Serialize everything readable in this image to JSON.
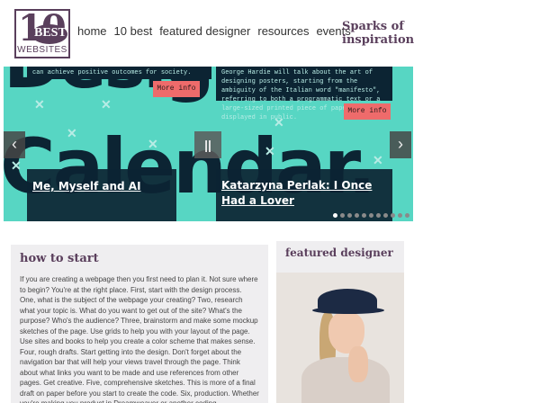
{
  "logo": {
    "number": "10",
    "badge": "BEST",
    "caption": "WEBSITES"
  },
  "nav": {
    "items": [
      "home",
      "10 best",
      "featured designer",
      "resources",
      "events"
    ],
    "tagline": "Sparks of inspiration"
  },
  "carousel": {
    "bg_word_top": "Design",
    "bg_word_main": "Calendar.",
    "slides": [
      {
        "excerpt": "can achieve positive outcomes for society.",
        "button": "More info",
        "card_title": "Me, Myself and AI"
      },
      {
        "excerpt": "George Hardie will talk about the art of designing posters, starting from the ambiguity of the Italian word \"manifesto\", referring to both a programmatic text or a large-sized printed piece of paper displayed in public.",
        "button": "More info",
        "card_title": "Katarzyna Perlak: I Once Had a Lover"
      }
    ],
    "prev_icon": "chevron-left-icon",
    "next_icon": "chevron-right-icon",
    "pause_icon": "pause-icon",
    "dot_count": 11,
    "active_dot": 0,
    "accent_color": "#57d6c3",
    "dark_color": "#0c2433",
    "button_color": "#ee6b6b"
  },
  "main": {
    "title": "how to start",
    "body": "If you are creating a webpage then you first need to plan it. Not sure where to begin? You're at the right place. First, start with the design process. One, what is the subject of the webpage your creating? Two, research what your topic is. What do you want to get out of the site? What's the purpose? Who's the audience? Three, brainstorm and make some mockup sketches of the page. Use grids to help you with your layout of the page. Use sites and books to help you create a color scheme that makes sense. Four, rough drafts. Start getting into the design. Don't forget about the navigation bar that will help your views travel through the page. Think about what links you want to be made and use references from other pages. Get creative. Five, comprehensive sketches. This is more of a final draft on paper before you start to create the code. Six, production. Whether you're making you product in Dreamweaver or another coding"
  },
  "sidebar": {
    "title": "featured designer"
  }
}
